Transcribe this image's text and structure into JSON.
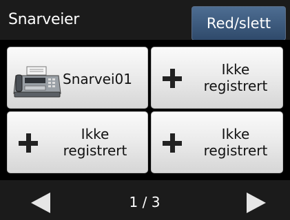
{
  "header": {
    "title": "Snarveier",
    "edit_button": "Red/slett"
  },
  "shortcuts": [
    {
      "label": "Snarvei01",
      "icon": "fax-icon"
    },
    {
      "label": "Ikke\nregistrert",
      "icon": "plus-icon"
    },
    {
      "label": "Ikke\nregistrert",
      "icon": "plus-icon"
    },
    {
      "label": "Ikke\nregistrert",
      "icon": "plus-icon"
    }
  ],
  "footer": {
    "page_indicator": "1 / 3",
    "prev_icon": "arrow-left-icon",
    "next_icon": "arrow-right-icon"
  },
  "colors": {
    "accent_button": "#3b5a7e",
    "background": "#000000",
    "bar": "#1b1b1b"
  }
}
